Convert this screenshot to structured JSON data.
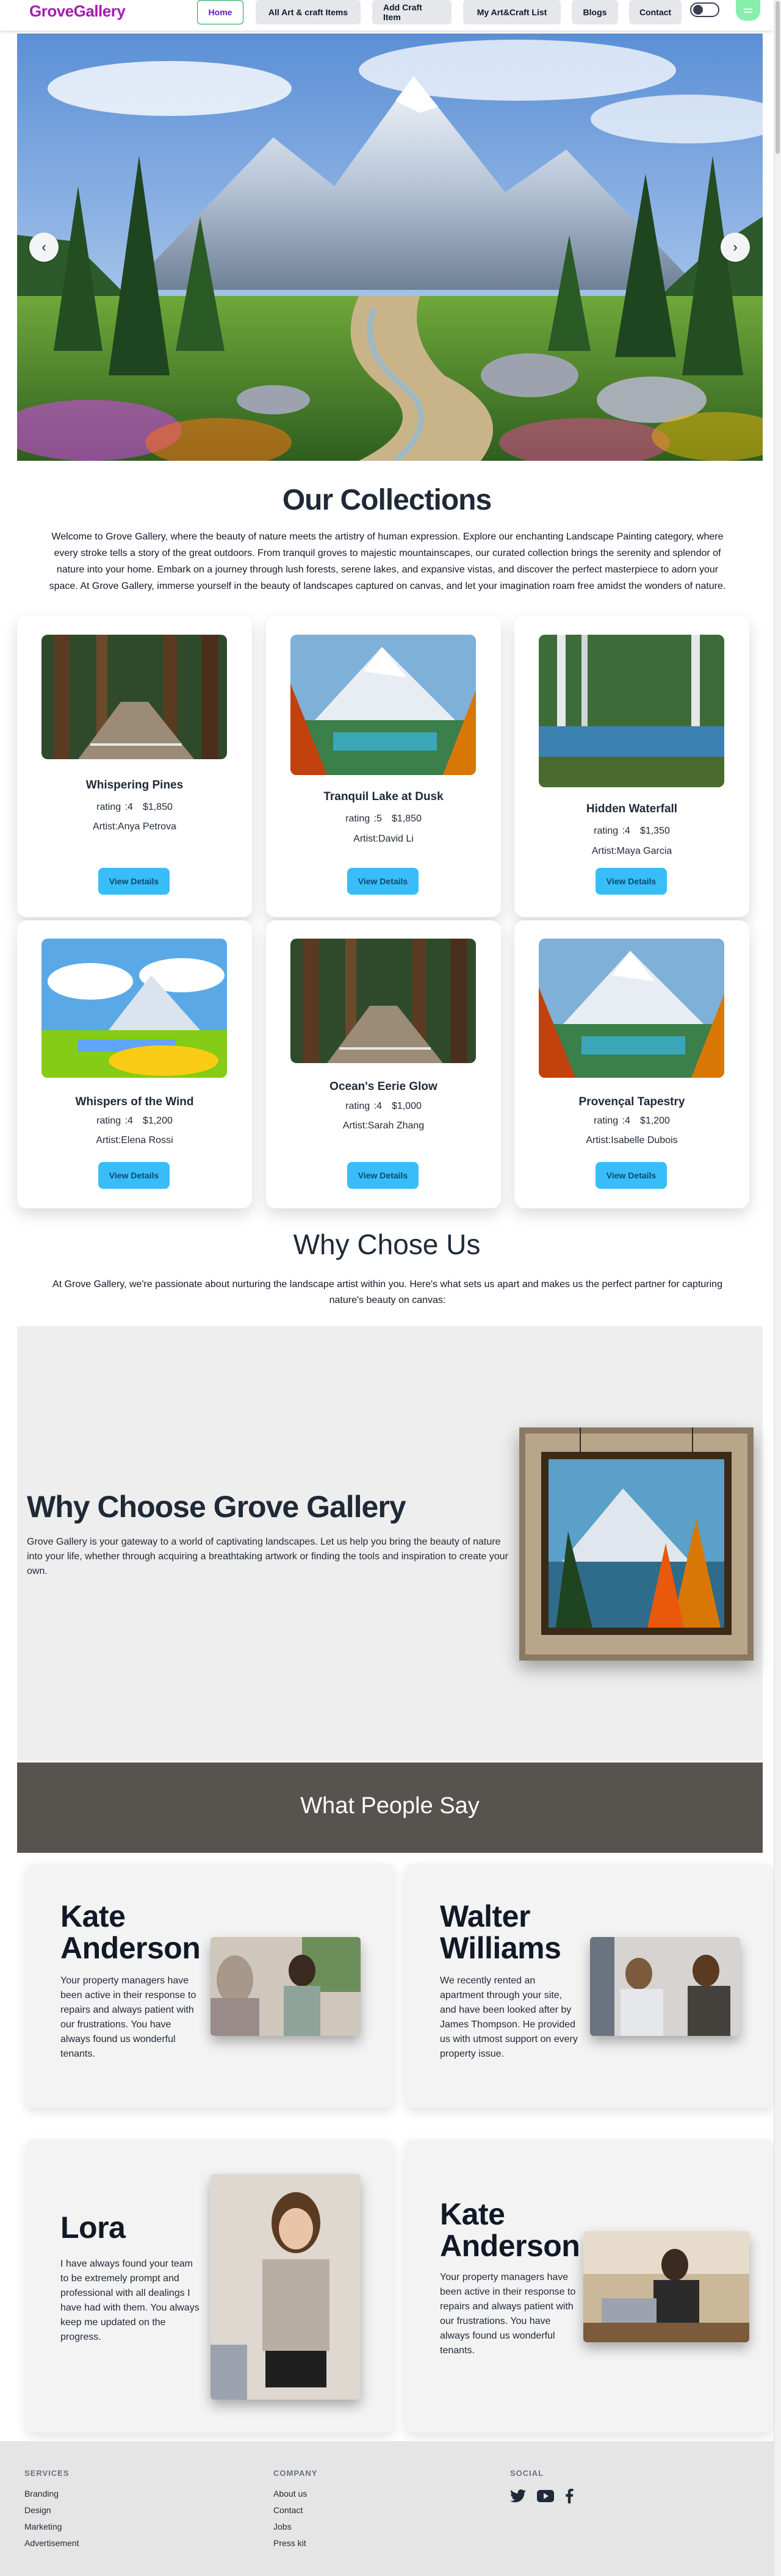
{
  "nav": {
    "logo": "GroveGallery",
    "items": [
      "Home",
      "All Art & craft Items",
      "Add Craft Item",
      "My Art&Craft List",
      "Blogs",
      "Contact"
    ]
  },
  "hero": {
    "prev_icon": "‹",
    "next_icon": "›"
  },
  "collections": {
    "title": "Our Collections",
    "intro": "Welcome to Grove Gallery, where the beauty of nature meets the artistry of human expression. Explore our enchanting Landscape Painting category, where every stroke tells a story of the great outdoors. From tranquil groves to majestic mountainscapes, our curated collection brings the serenity and splendor of nature into your home. Embark on a journey through lush forests, serene lakes, and expansive vistas, and discover the perfect masterpiece to adorn your space. At Grove Gallery, immerse yourself in the beauty of landscapes captured on canvas, and let your imagination roam free amidst the wonders of nature.",
    "button_label": "View Details",
    "cards": [
      {
        "title": "Whispering Pines",
        "rating": "rating :4",
        "price": "$1,850",
        "artist": "Artist:Anya Petrova"
      },
      {
        "title": "Tranquil Lake at Dusk",
        "rating": "rating :5",
        "price": "$1,850",
        "artist": "Artist:David Li"
      },
      {
        "title": "Hidden Waterfall",
        "rating": "rating :4",
        "price": "$1,350",
        "artist": "Artist:Maya Garcia"
      },
      {
        "title": "Whispers of the Wind",
        "rating": "rating :4",
        "price": "$1,200",
        "artist": "Artist:Elena Rossi"
      },
      {
        "title": "Ocean's Eerie Glow",
        "rating": "rating :4",
        "price": "$1,000",
        "artist": "Artist:Sarah Zhang"
      },
      {
        "title": "Provençal Tapestry",
        "rating": "rating :4",
        "price": "$1,200",
        "artist": "Artist:Isabelle Dubois"
      }
    ]
  },
  "why": {
    "title": "Why Chose Us",
    "intro": "At Grove Gallery, we're passionate about nurturing the landscape artist within you. Here's what sets us apart and makes us the perfect partner for capturing nature's beauty on canvas:",
    "heading": "Why Choose Grove Gallery",
    "text": "Grove Gallery is your gateway to a world of captivating landscapes. Let us help you bring the beauty of nature into your life, whether through acquiring a breathtaking artwork or finding the tools and inspiration to create your own."
  },
  "testimonials": {
    "title": "What People Say",
    "items": [
      {
        "name": "Kate Anderson",
        "text": "Your property managers have been active in their response to repairs and always patient with our frustrations. You have always found us wonderful tenants."
      },
      {
        "name": "Walter Williams",
        "text": "We recently rented an apartment through your site, and have been looked after by James Thompson. He provided us with utmost support on every property issue."
      },
      {
        "name": "Lora",
        "text": "I have always found your team to be extremely prompt and professional with all dealings I have had with them. You always keep me updated on the progress."
      },
      {
        "name": "Kate Anderson",
        "text": "Your property managers have been active in their response to repairs and always patient with our frustrations. You have always found us wonderful tenants."
      }
    ]
  },
  "footer": {
    "services": {
      "title": "SERVICES",
      "links": [
        "Branding",
        "Design",
        "Marketing",
        "Advertisement"
      ]
    },
    "company": {
      "title": "COMPANY",
      "links": [
        "About us",
        "Contact",
        "Jobs",
        "Press kit"
      ]
    },
    "social": {
      "title": "SOCIAL",
      "icons": [
        "twitter-icon",
        "youtube-icon",
        "facebook-icon"
      ]
    }
  },
  "colors": {
    "brand": "#a21caf",
    "accent": "#38bdf8",
    "band": "#57534e"
  }
}
